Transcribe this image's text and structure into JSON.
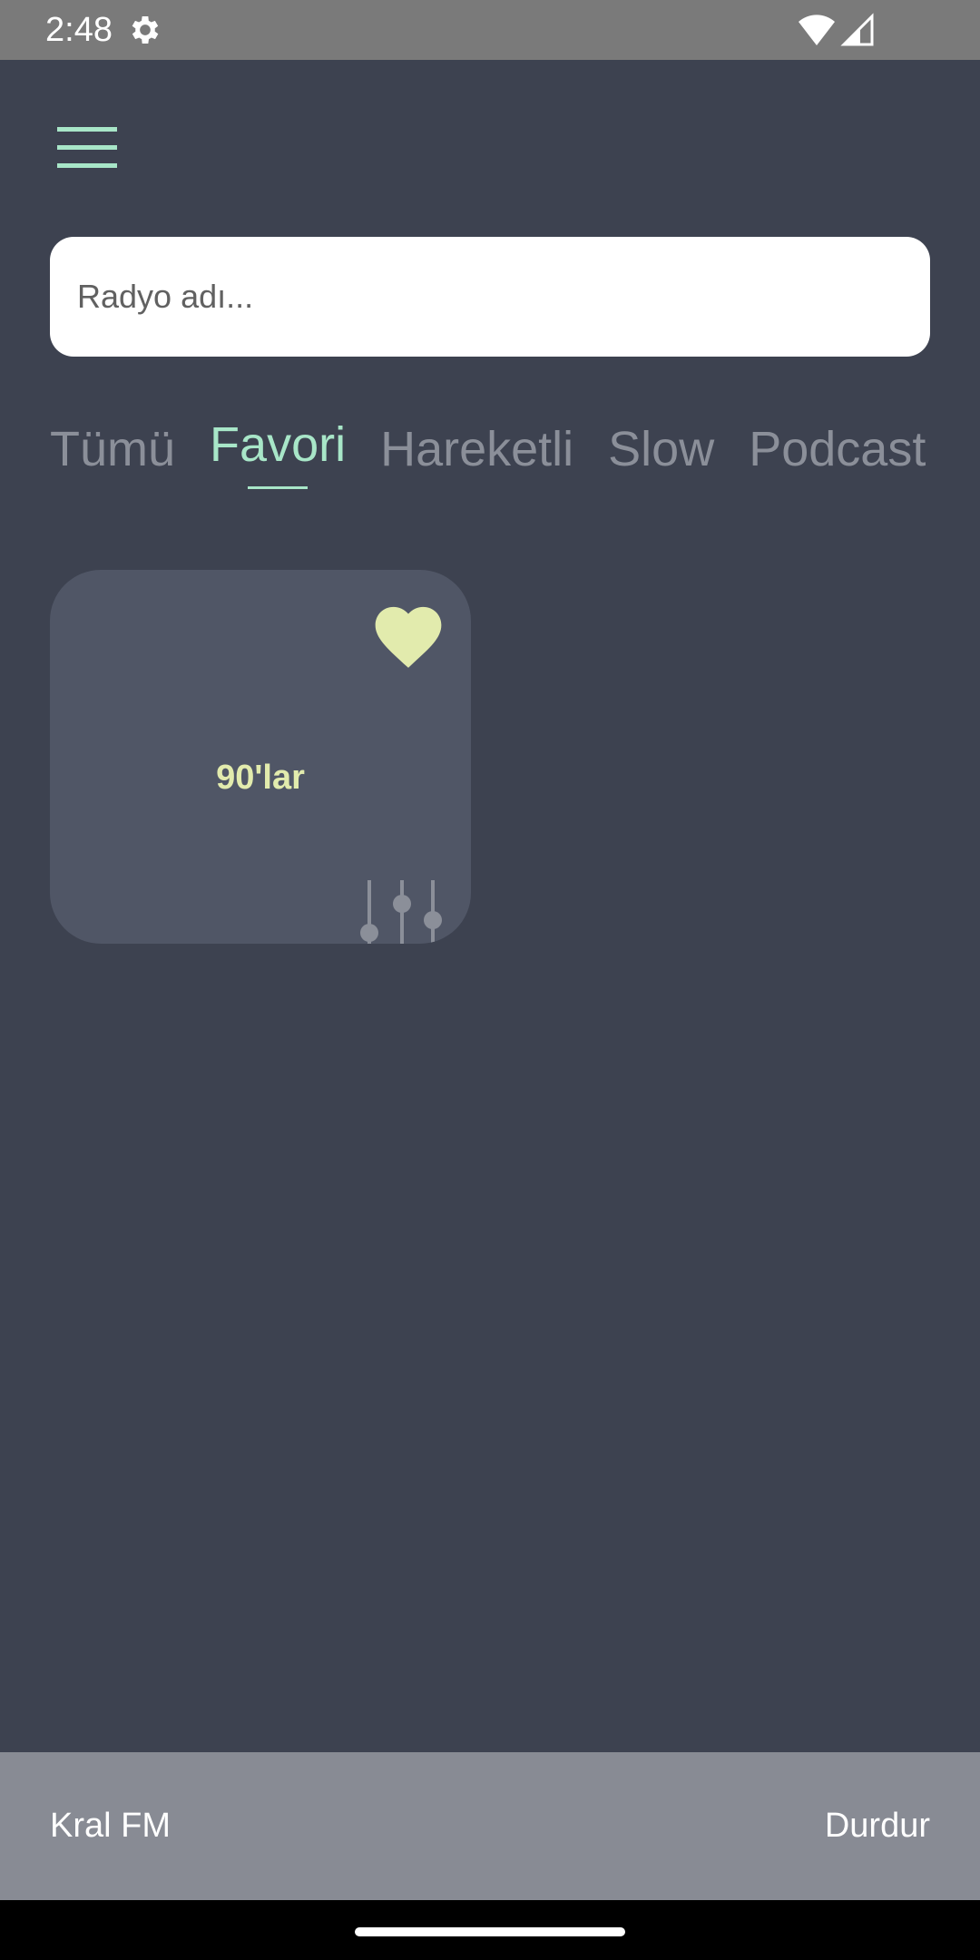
{
  "status_bar": {
    "time": "2:48",
    "icons": [
      "gear-icon",
      "wifi-icon",
      "cell-signal-icon"
    ]
  },
  "header": {
    "menu_icon": "hamburger-menu-icon"
  },
  "search": {
    "placeholder": "Radyo adı...",
    "value": ""
  },
  "tabs": [
    {
      "label": "Tümü",
      "active": false
    },
    {
      "label": "Favori",
      "active": true
    },
    {
      "label": "Hareketli",
      "active": false
    },
    {
      "label": "Slow",
      "active": false
    },
    {
      "label": "Podcast",
      "active": false
    }
  ],
  "stations": [
    {
      "name": "90'lar",
      "favorite": true,
      "icons": [
        "heart-icon",
        "equalizer-icon"
      ]
    }
  ],
  "player": {
    "now_playing": "Kral FM",
    "stop_label": "Durdur"
  },
  "colors": {
    "background": "#3d4250",
    "accent": "#a8e6c8",
    "card": "#505666",
    "card_title": "#e2ebad",
    "heart": "#e2ebad",
    "player_bar": "#888b94",
    "tab_inactive": "#8b8f99"
  }
}
